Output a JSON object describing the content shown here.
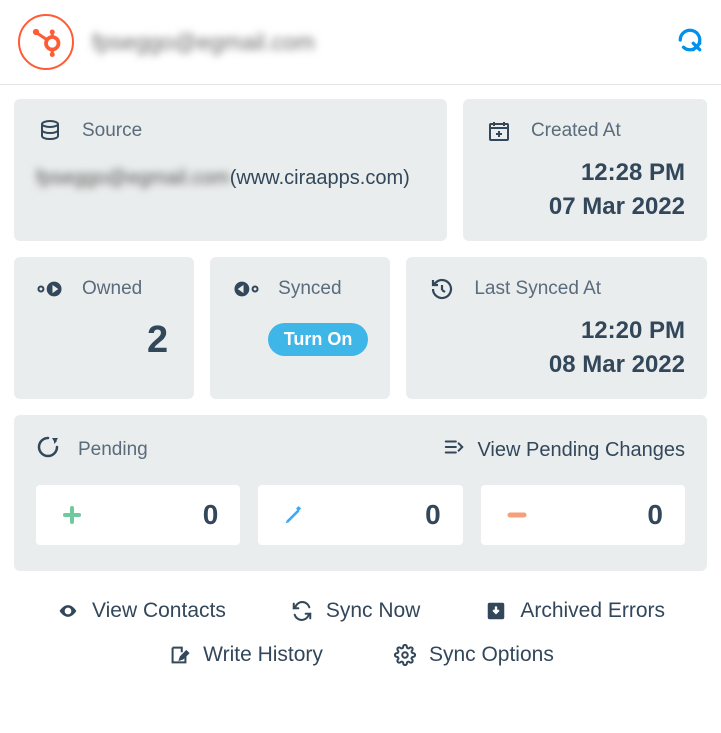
{
  "header": {
    "email": "fpseggo@egmail.com"
  },
  "source": {
    "label": "Source",
    "email_prefix": "fpseggo@egmail.com",
    "domain": "(www.ciraapps.com)"
  },
  "created": {
    "label": "Created At",
    "time": "12:28 PM",
    "date": "07 Mar 2022"
  },
  "owned": {
    "label": "Owned",
    "count": "2"
  },
  "synced": {
    "label": "Synced",
    "button": "Turn On"
  },
  "last_synced": {
    "label": "Last Synced At",
    "time": "12:20 PM",
    "date": "08 Mar 2022"
  },
  "pending": {
    "label": "Pending",
    "view_link": "View Pending Changes",
    "add_count": "0",
    "edit_count": "0",
    "remove_count": "0"
  },
  "actions": {
    "view_contacts": "View Contacts",
    "sync_now": "Sync Now",
    "archived_errors": "Archived Errors",
    "write_history": "Write History",
    "sync_options": "Sync Options"
  }
}
